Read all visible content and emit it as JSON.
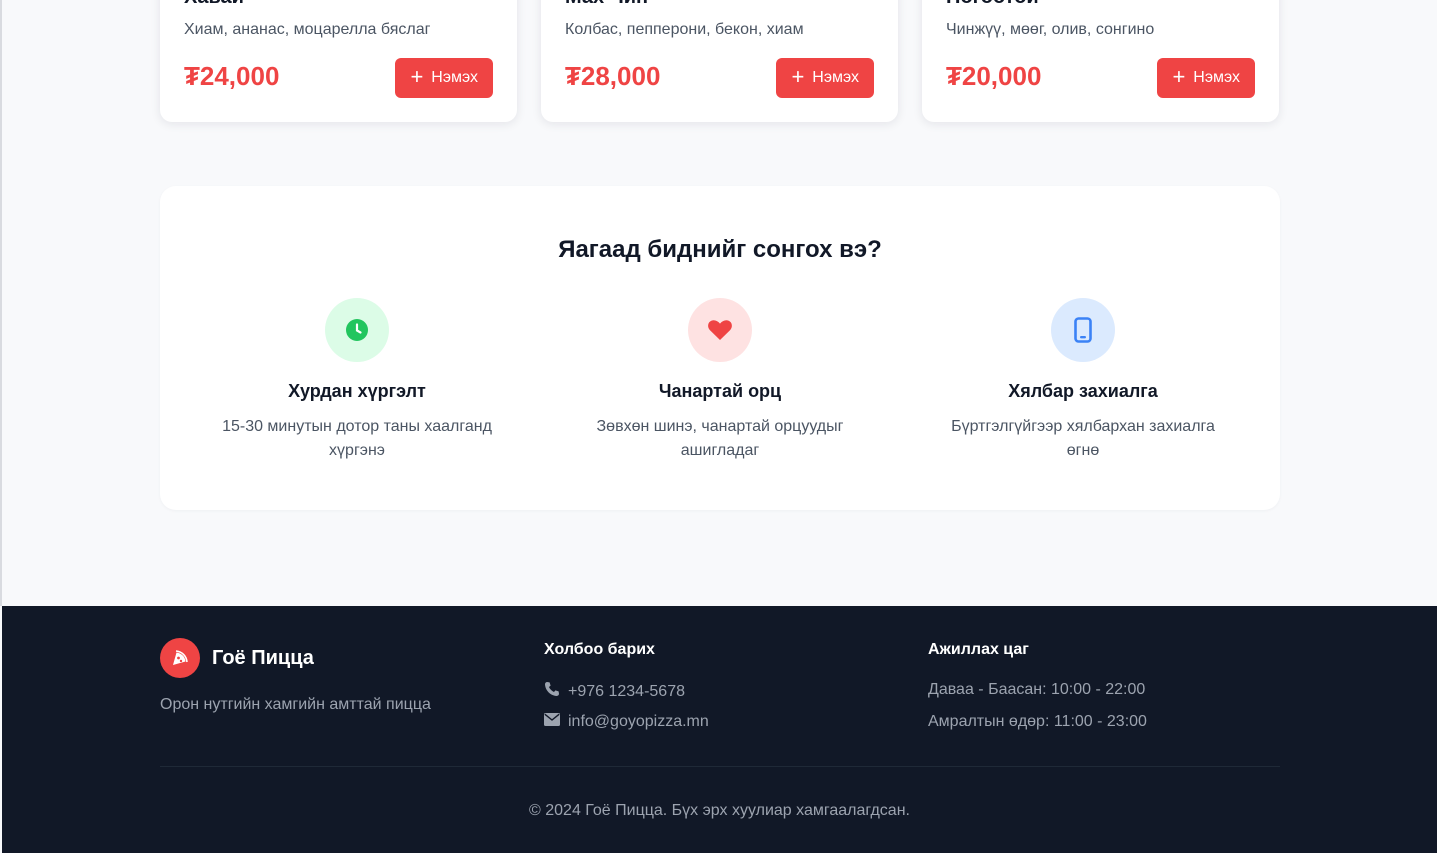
{
  "products": [
    {
      "name": "Хавай",
      "desc": "Хиам, ананас, моцарелла бяслаг",
      "price": "₮24,000",
      "add_label": "Нэмэх"
    },
    {
      "name": "Мах Чин",
      "desc": "Колбас, пепперони, бекон, хиам",
      "price": "₮28,000",
      "add_label": "Нэмэх"
    },
    {
      "name": "Ногоотой",
      "desc": "Чинжүү, мөөг, олив, сонгино",
      "price": "₮20,000",
      "add_label": "Нэмэх"
    }
  ],
  "why": {
    "title": "Яагаад биднийг сонгох вэ?",
    "features": [
      {
        "icon": "clock-icon",
        "title": "Хурдан хүргэлт",
        "desc": "15-30 минутын дотор таны хаалганд хүргэнэ",
        "bg": "#dcfce7",
        "color": "#22c55e"
      },
      {
        "icon": "heart-icon",
        "title": "Чанартай орц",
        "desc": "Зөвхөн шинэ, чанартай орцуудыг ашигладаг",
        "bg": "#fee2e2",
        "color": "#ef4444"
      },
      {
        "icon": "mobile-icon",
        "title": "Хялбар захиалга",
        "desc": "Бүртгэлгүйгээр хялбархан захиалга өгнө",
        "bg": "#dbeafe",
        "color": "#3b82f6"
      }
    ]
  },
  "footer": {
    "brand": "Гоё Пицца",
    "tagline": "Орон нутгийн хамгийн амттай пицца",
    "contact_heading": "Холбоо барих",
    "phone": "+976 1234-5678",
    "email": "info@goyopizza.mn",
    "hours_heading": "Ажиллах цаг",
    "weekday_hours": "Даваа - Баасан: 10:00 - 22:00",
    "weekend_hours": "Амралтын өдөр: 11:00 - 23:00",
    "copyright": "© 2024 Гоё Пицца. Бүх эрх хуулиар хамгаалагдсан."
  },
  "colors": {
    "accent": "#ef4444",
    "footer_bg": "#111827"
  }
}
